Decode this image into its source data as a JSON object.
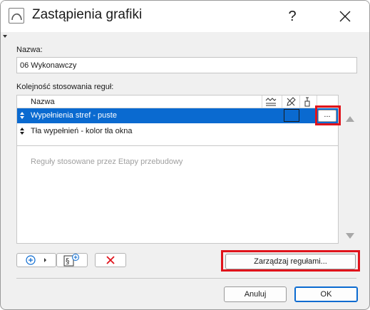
{
  "window": {
    "title": "Zastąpienia grafiki",
    "help_label": "?",
    "close_label": "✕"
  },
  "name_section": {
    "label": "Nazwa:",
    "value": "06 Wykonawczy"
  },
  "rules_section": {
    "label": "Kolejność stosowania reguł:",
    "column_name": "Nazwa",
    "column_icons": [
      "fill-pattern-icon",
      "pen-override-icon",
      "paint-brush-icon"
    ],
    "rows": [
      {
        "name": "Wypełnienia stref - puste",
        "selected": true,
        "swatch_color": "#0a6ad0",
        "button_label": "..."
      },
      {
        "name": "Tła wypełnień - kolor tła okna",
        "selected": false
      }
    ],
    "renovation_note": "Reguły stosowane przez Etapy przebudowy"
  },
  "toolbar": {
    "add_icon": "add-circle-icon",
    "section_icon": "section-add-icon",
    "delete_icon": "delete-x-icon"
  },
  "manage_button_label": "Zarządzaj regułami...",
  "footer": {
    "cancel_label": "Anuluj",
    "ok_label": "OK"
  },
  "colors": {
    "selection": "#0a6ad0",
    "highlight": "#e0131b",
    "delete_red": "#e0131b"
  }
}
